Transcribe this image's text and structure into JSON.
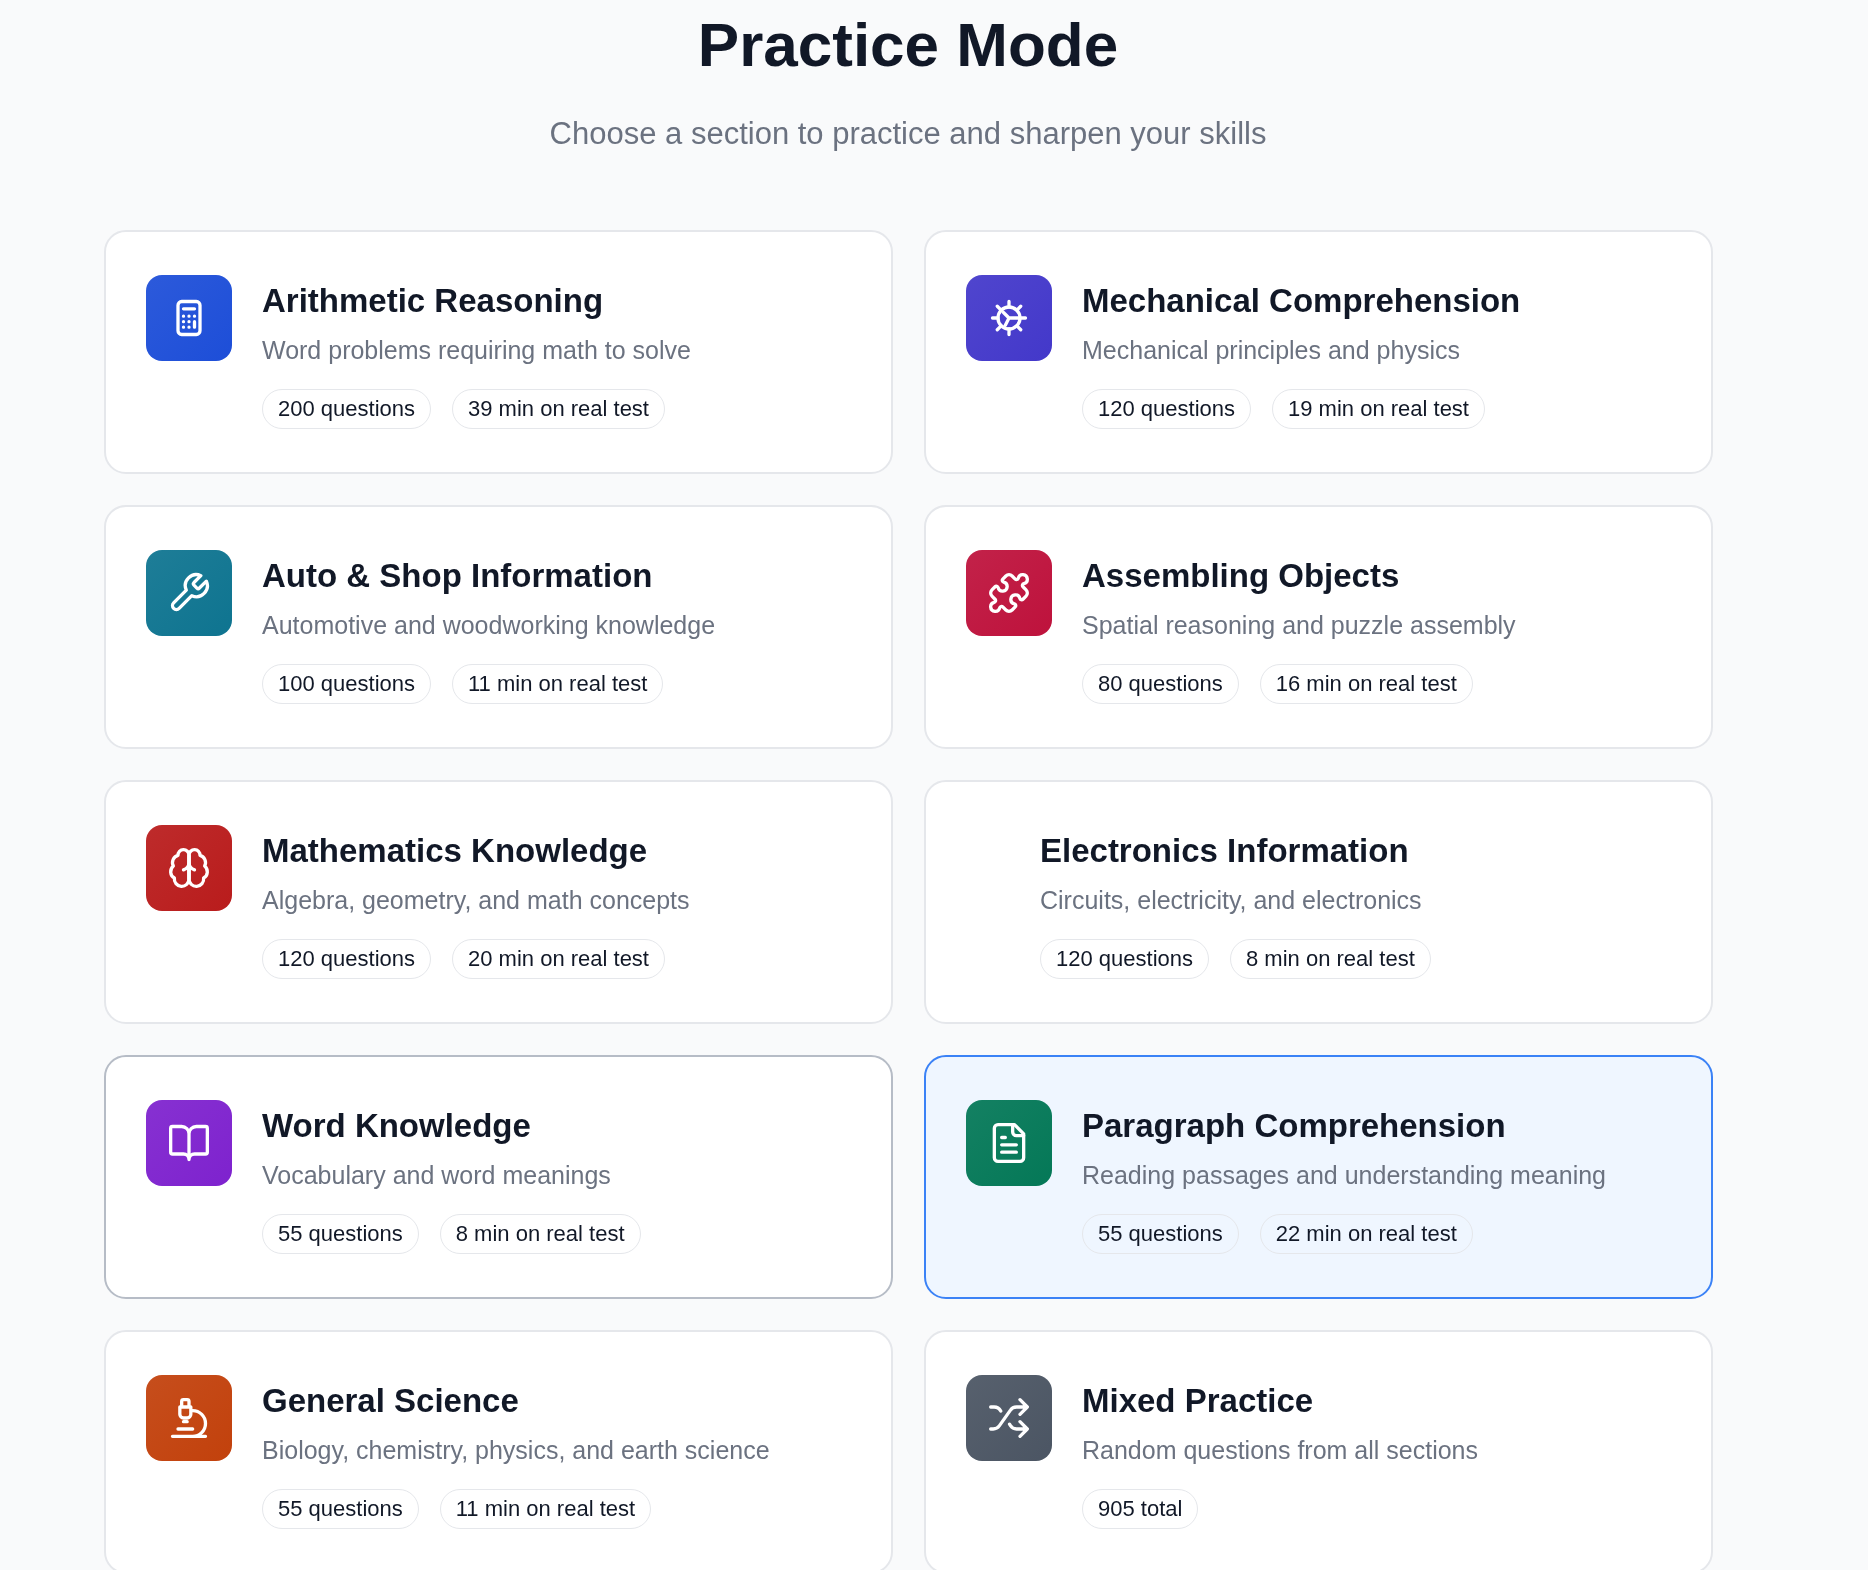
{
  "title": "Practice Mode",
  "subtitle": "Choose a section to practice and sharpen your skills",
  "sections": [
    {
      "kind": "calculator",
      "color": "#1d4ed8",
      "title": "Arithmetic Reasoning",
      "description": "Word problems requiring math to solve",
      "tags": [
        "200 questions",
        "39 min on real test"
      ],
      "selected": false,
      "hovered": false
    },
    {
      "kind": "gear",
      "color": "#4338ca",
      "title": "Mechanical Comprehension",
      "description": "Mechanical principles and physics",
      "tags": [
        "120 questions",
        "19 min on real test"
      ],
      "selected": false,
      "hovered": false
    },
    {
      "kind": "wrench",
      "color": "#0e7490",
      "title": "Auto & Shop Information",
      "description": "Automotive and woodworking knowledge",
      "tags": [
        "100 questions",
        "11 min on real test"
      ],
      "selected": false,
      "hovered": false
    },
    {
      "kind": "puzzle",
      "color": "#be123c",
      "title": "Assembling Objects",
      "description": "Spatial reasoning and puzzle assembly",
      "tags": [
        "80 questions",
        "16 min on real test"
      ],
      "selected": false,
      "hovered": false
    },
    {
      "kind": "brain",
      "color": "#b91c1c",
      "title": "Mathematics Knowledge",
      "description": "Algebra, geometry, and math concepts",
      "tags": [
        "120 questions",
        "20 min on real test"
      ],
      "selected": false,
      "hovered": false
    },
    {
      "kind": "plain",
      "title": "Electronics Information",
      "description": "Circuits, electricity, and electronics",
      "tags": [
        "120 questions",
        "8 min on real test"
      ],
      "selected": false,
      "hovered": false
    },
    {
      "kind": "book",
      "color": "#7e22ce",
      "title": "Word Knowledge",
      "description": "Vocabulary and word meanings",
      "tags": [
        "55 questions",
        "8 min on real test"
      ],
      "selected": false,
      "hovered": true
    },
    {
      "kind": "document",
      "color": "#047857",
      "title": "Paragraph Comprehension",
      "description": "Reading passages and understanding meaning",
      "tags": [
        "55 questions",
        "22 min on real test"
      ],
      "selected": true,
      "hovered": false
    },
    {
      "kind": "microscope",
      "color": "#c2410c",
      "title": "General Science",
      "description": "Biology, chemistry, physics, and earth science",
      "tags": [
        "55 questions",
        "11 min on real test"
      ],
      "selected": false,
      "hovered": false
    },
    {
      "kind": "shuffle",
      "color": "#4b5563",
      "title": "Mixed Practice",
      "description": "Random questions from all sections",
      "tags": [
        "905 total"
      ],
      "selected": false,
      "hovered": false
    }
  ]
}
